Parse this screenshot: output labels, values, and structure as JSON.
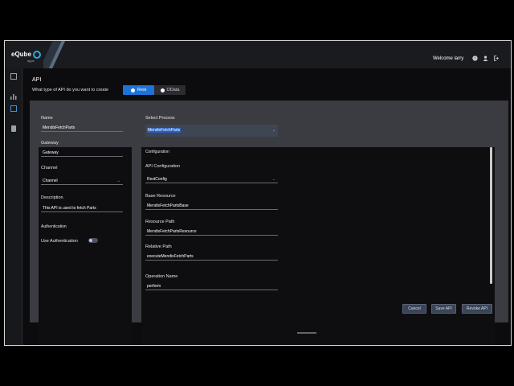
{
  "header": {
    "logo_text": "eQube",
    "logo_sub": "apps",
    "welcome": "Welcome larry",
    "icons": [
      "help-icon",
      "user-icon",
      "logout-icon"
    ]
  },
  "sidebar": {
    "items": [
      "dashboard-icon",
      "chart-icon",
      "api-icon",
      "database-icon"
    ]
  },
  "page": {
    "title": "API",
    "question": "What type of API do you want to create",
    "options": {
      "rest": "Rest",
      "odata": "OData"
    }
  },
  "left": {
    "name_label": "Name",
    "name_value": "MendixFetchParts",
    "gateway_label": "Gateway",
    "gateway_value": "Gateway",
    "channel_label": "Channel",
    "channel_value": "Channel",
    "description_label": "Description",
    "description_value": "This API is used to fetch Parts",
    "auth_section": "Authentication",
    "use_auth_label": "Use Authentication",
    "use_auth_value": false
  },
  "right": {
    "select_process_label": "Select Process",
    "select_process_value": "MendixFetchParts",
    "config_section": "Configuration",
    "api_config_label": "API Configuration",
    "api_config_value": "RestConfig",
    "base_resource_label": "Base Resource",
    "base_resource_value": "MendixFetchPartsBase",
    "resource_path_label": "Resource Path",
    "resource_path_value": "MendixFetchPartsResource",
    "relative_path_label": "Relative Path",
    "relative_path_value": "executeMendixFetchParts",
    "operation_name_label": "Operation Name",
    "operation_name_value": "perform"
  },
  "actions": {
    "cancel": "Cancel",
    "save": "Save API",
    "revoke": "Revoke API"
  },
  "colors": {
    "accent": "#1e73d8",
    "panel": "#0e0e11",
    "frame": "#3b3c42"
  }
}
